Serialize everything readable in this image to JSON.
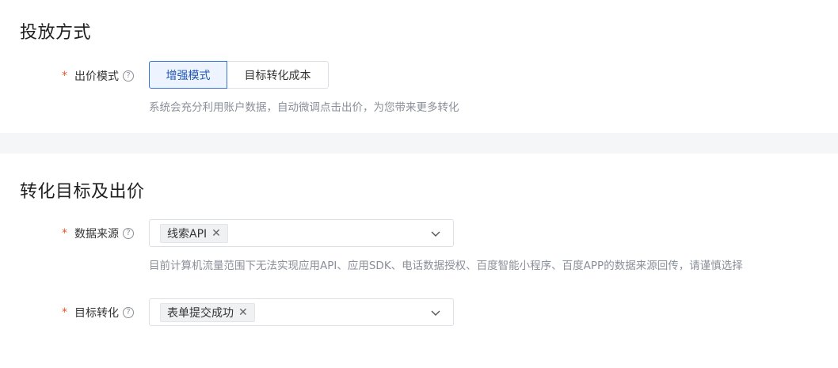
{
  "section1": {
    "title": "投放方式",
    "bid_mode": {
      "required_mark": "*",
      "label": "出价模式",
      "help_icon": "question-circle-icon",
      "options": [
        "增强模式",
        "目标转化成本"
      ],
      "selected": "增强模式",
      "hint": "系统会充分利用账户数据，自动微调点击出价，为您带来更多转化"
    }
  },
  "section2": {
    "title": "转化目标及出价",
    "data_source": {
      "required_mark": "*",
      "label": "数据来源",
      "help_icon": "question-circle-icon",
      "tags": [
        "线索API"
      ],
      "hint": "目前计算机流量范围下无法实现应用API、应用SDK、电话数据授权、百度智能小程序、百度APP的数据来源回传，请谨慎选择"
    },
    "target_conversion": {
      "required_mark": "*",
      "label": "目标转化",
      "help_icon": "question-circle-icon",
      "tags": [
        "表单提交成功"
      ]
    }
  },
  "colors": {
    "accent": "#3a73d6",
    "required": "#e5532b",
    "hint": "#8a8f99",
    "band": "#f5f6f8"
  }
}
